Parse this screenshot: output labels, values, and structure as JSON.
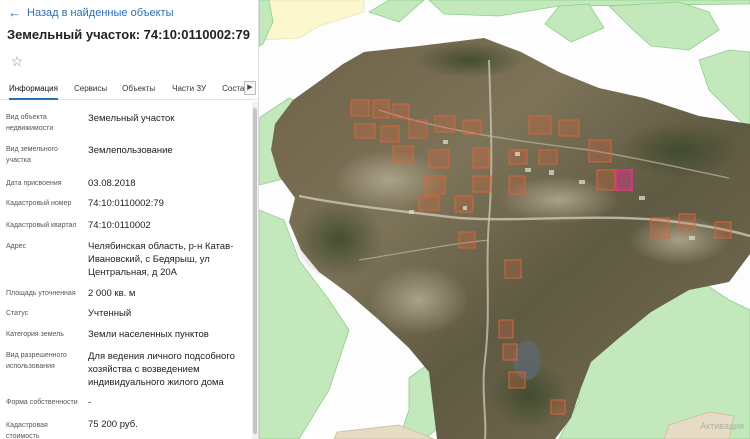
{
  "header": {
    "back_label": "Назад в найденные объекты",
    "title": "Земельный участок: 74:10:0110002:79"
  },
  "tabs": [
    {
      "label": "Информация",
      "active": true
    },
    {
      "label": "Сервисы",
      "active": false
    },
    {
      "label": "Объекты",
      "active": false
    },
    {
      "label": "Части ЗУ",
      "active": false
    },
    {
      "label": "Состав",
      "active": false
    }
  ],
  "properties": [
    {
      "label": "Вид объекта недвижимости",
      "value": "Земельный участок"
    },
    {
      "label": "Вид земельного участка",
      "value": "Землепользование"
    },
    {
      "label": "Дата присвоения",
      "value": "03.08.2018"
    },
    {
      "label": "Кадастровый номер",
      "value": "74:10:0110002:79"
    },
    {
      "label": "Кадастровый квартал",
      "value": "74:10:0110002"
    },
    {
      "label": "Адрес",
      "value": "Челябинская область, р-н Катав-Ивановский, с Бедярыш, ул Центральная, д 20А"
    },
    {
      "label": "Площадь уточненная",
      "value": "2 000 кв. м"
    },
    {
      "label": "Статус",
      "value": "Учтенный"
    },
    {
      "label": "Категория земель",
      "value": "Земли населенных пунктов"
    },
    {
      "label": "Вид разрешенного использования",
      "value": "Для ведения личного подсобного хозяйства с возведением индивидуального жилого дома"
    },
    {
      "label": "Форма собственности",
      "value": "-"
    },
    {
      "label": "Кадастровая стоимость",
      "value": "75 200 руб."
    }
  ],
  "map": {
    "watermark": "Активация",
    "colors": {
      "green": "#c2e8bb",
      "green_stroke": "#8fcf8a",
      "yellow": "#fbf8d0",
      "tan": "#e6dcc5",
      "parcel": "#d9653c",
      "highlight": "#e0338a"
    }
  },
  "icons": {
    "back": "arrow-left-icon",
    "favorite": "star-outline-icon",
    "tabs_next": "chevron-right-icon"
  }
}
